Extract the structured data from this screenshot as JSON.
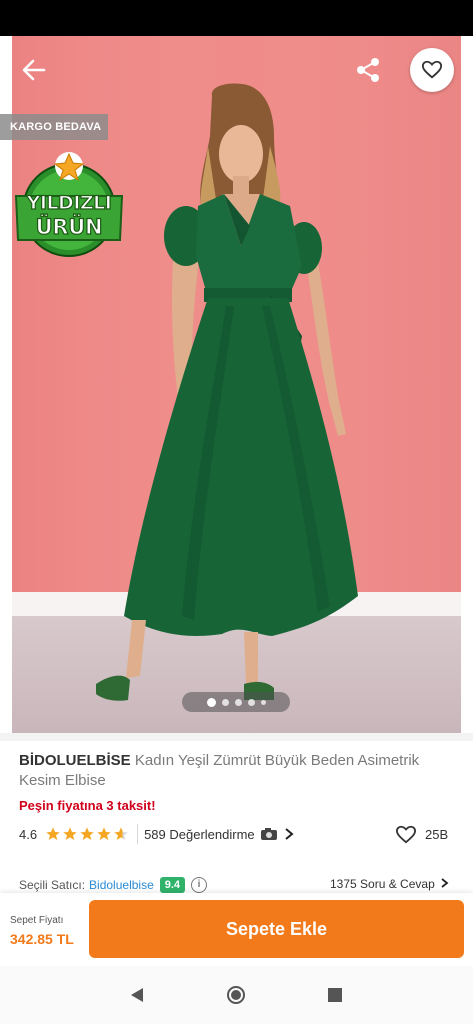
{
  "product": {
    "brand": "BİDOLUELBİSE",
    "name": "Kadın Yeşil Zümrüt Büyük Beden Asimetrik Kesim Elbise",
    "promo": "Peşin fiyatına 3 taksit!",
    "rating": "4.6",
    "rating_value": 4.6,
    "reviews": "589 Değerlendirme",
    "likes": "25B"
  },
  "hero": {
    "kargo_badge": "KARGO BEDAVA",
    "star_badge_line1": "YILDIZLI",
    "star_badge_line2": "ÜRÜN",
    "image_count": 5,
    "active_image": 1
  },
  "seller": {
    "label": "Seçili Satıcı:",
    "name": "Bidoluelbise",
    "score": "9.4",
    "qa": "1375 Soru & Cevap"
  },
  "cart": {
    "price_label": "Sepet Fiyatı",
    "price": "342.85 TL",
    "button": "Sepete Ekle"
  },
  "icons": {
    "back": "arrow-left-icon",
    "share": "share-icon",
    "favorite": "heart-icon",
    "camera": "camera-icon",
    "chevron": "chevron-right-icon"
  },
  "colors": {
    "accent": "#f27a1a",
    "promo": "#d0011b",
    "seller_link": "#2a8bd6",
    "score_badge": "#2fb36b",
    "star": "#f5a623",
    "dress": "#155f37",
    "backdrop": "#ef8c8a"
  }
}
